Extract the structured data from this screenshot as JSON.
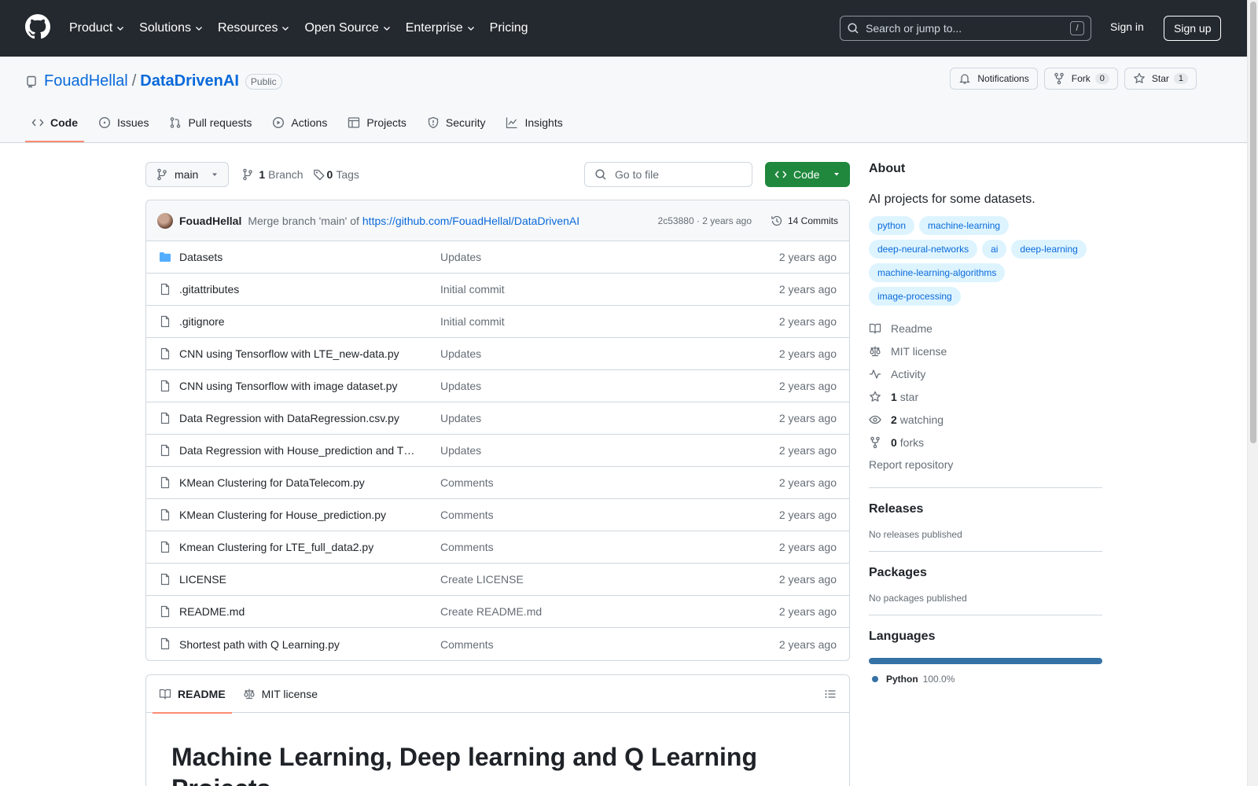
{
  "header": {
    "nav": [
      {
        "label": "Product",
        "dropdown": true
      },
      {
        "label": "Solutions",
        "dropdown": true
      },
      {
        "label": "Resources",
        "dropdown": true
      },
      {
        "label": "Open Source",
        "dropdown": true
      },
      {
        "label": "Enterprise",
        "dropdown": true
      },
      {
        "label": "Pricing",
        "dropdown": false
      }
    ],
    "search_placeholder": "Search or jump to...",
    "search_shortcut": "/",
    "sign_in": "Sign in",
    "sign_up": "Sign up"
  },
  "repo": {
    "owner": "FouadHellal",
    "separator": "/",
    "name": "DataDrivenAI",
    "visibility": "Public",
    "notifications_label": "Notifications",
    "fork_label": "Fork",
    "fork_count": "0",
    "star_label": "Star",
    "star_count": "1",
    "tabs": [
      {
        "label": "Code",
        "icon": "code-icon",
        "active": true
      },
      {
        "label": "Issues",
        "icon": "issue-icon"
      },
      {
        "label": "Pull requests",
        "icon": "pull-request-icon"
      },
      {
        "label": "Actions",
        "icon": "play-icon"
      },
      {
        "label": "Projects",
        "icon": "table-icon"
      },
      {
        "label": "Security",
        "icon": "shield-icon"
      },
      {
        "label": "Insights",
        "icon": "graph-icon"
      }
    ]
  },
  "toolbar": {
    "branch": "main",
    "branch_count": "1",
    "branch_label": "Branch",
    "tag_count": "0",
    "tag_label": "Tags",
    "goto_placeholder": "Go to file",
    "code_button": "Code"
  },
  "commit": {
    "author": "FouadHellal",
    "message": "Merge branch 'main' of",
    "link": "https://github.com/FouadHellal/DataDrivenAI",
    "meta": "2c53880 · 2 years ago",
    "commits_label": "14 Commits"
  },
  "files": [
    {
      "name": "Datasets",
      "type": "folder",
      "message": "Updates",
      "date": "2 years ago"
    },
    {
      "name": ".gitattributes",
      "type": "file",
      "message": "Initial commit",
      "date": "2 years ago"
    },
    {
      "name": ".gitignore",
      "type": "file",
      "message": "Initial commit",
      "date": "2 years ago"
    },
    {
      "name": "CNN using Tensorflow with LTE_new-data.py",
      "type": "file",
      "message": "Updates",
      "date": "2 years ago"
    },
    {
      "name": "CNN using Tensorflow with image dataset.py",
      "type": "file",
      "message": "Updates",
      "date": "2 years ago"
    },
    {
      "name": "Data Regression with DataRegression.csv.py",
      "type": "file",
      "message": "Updates",
      "date": "2 years ago"
    },
    {
      "name": "Data Regression with House_prediction and T…",
      "type": "file",
      "message": "Updates",
      "date": "2 years ago"
    },
    {
      "name": "KMean Clustering for DataTelecom.py",
      "type": "file",
      "message": "Comments",
      "date": "2 years ago"
    },
    {
      "name": "KMean Clustering for House_prediction.py",
      "type": "file",
      "message": "Comments",
      "date": "2 years ago"
    },
    {
      "name": "Kmean Clustering for LTE_full_data2.py",
      "type": "file",
      "message": "Comments",
      "date": "2 years ago"
    },
    {
      "name": "LICENSE",
      "type": "file",
      "message": "Create LICENSE",
      "date": "2 years ago"
    },
    {
      "name": "README.md",
      "type": "file",
      "message": "Create README.md",
      "date": "2 years ago"
    },
    {
      "name": "Shortest path with Q Learning.py",
      "type": "file",
      "message": "Comments",
      "date": "2 years ago"
    }
  ],
  "readme": {
    "tab_readme": "README",
    "tab_license": "MIT license",
    "heading": "Machine Learning, Deep learning and Q Learning Projects"
  },
  "sidebar": {
    "about_title": "About",
    "description": "AI projects for some datasets.",
    "topics": [
      "python",
      "machine-learning",
      "deep-neural-networks",
      "ai",
      "deep-learning",
      "machine-learning-algorithms",
      "image-processing"
    ],
    "readme": "Readme",
    "license": "MIT license",
    "activity": "Activity",
    "stars_count": "1",
    "stars_label": "star",
    "watching_count": "2",
    "watching_label": "watching",
    "forks_count": "0",
    "forks_label": "forks",
    "report": "Report repository",
    "releases_title": "Releases",
    "releases_text": "No releases published",
    "packages_title": "Packages",
    "packages_text": "No packages published",
    "languages_title": "Languages",
    "language_name": "Python",
    "language_pct": "100.0%",
    "language_color": "#3572a5"
  },
  "colors": {
    "header_bg": "#24292f",
    "accent": "#0969da",
    "code_button": "#1f883d",
    "tab_underline": "#fd8c73"
  }
}
